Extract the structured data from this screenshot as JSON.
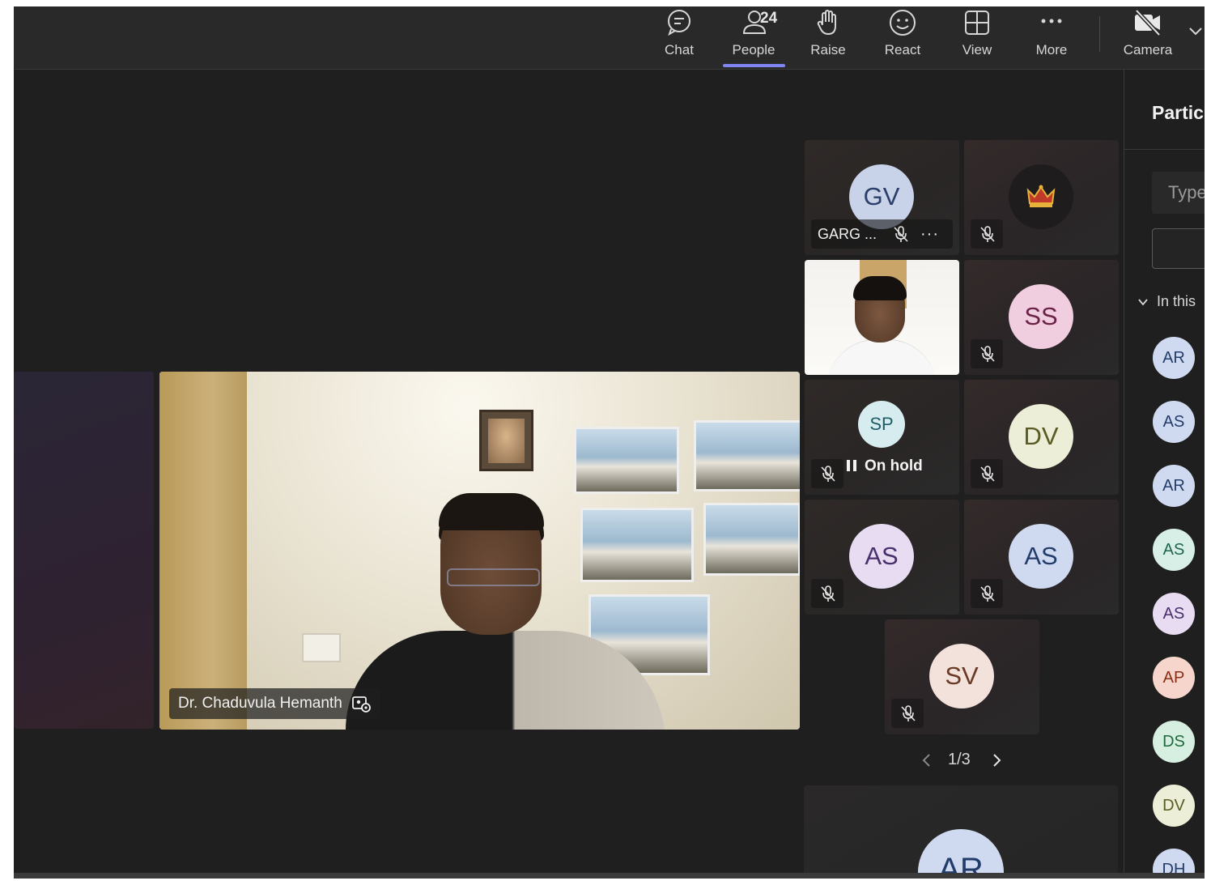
{
  "toolbar": {
    "chat_label": "Chat",
    "people_label": "People",
    "people_count": "24",
    "raise_label": "Raise",
    "react_label": "React",
    "view_label": "View",
    "more_label": "More",
    "camera_label": "Camera",
    "active_tab": "People",
    "accent_color": "#7f85f5"
  },
  "stage": {
    "main_speaker_name": "Dr. Chaduvula Hemanth",
    "tiles": [
      {
        "initials": "GV",
        "name": "GARG ...",
        "avatar_bg": "#c8d2e8",
        "avatar_fg": "#2b3f6b",
        "muted": true
      },
      {
        "initials": "",
        "name": "",
        "icon": "crown-icon",
        "muted": true
      },
      {
        "initials": "",
        "name": "",
        "video": true,
        "muted": false
      },
      {
        "initials": "SS",
        "name": "",
        "avatar_bg": "#f1cde0",
        "avatar_fg": "#6b2248",
        "muted": true
      },
      {
        "initials": "SP",
        "name": "",
        "status": "On hold",
        "avatar_bg": "#d7ecef",
        "avatar_fg": "#1f5d66",
        "muted": true
      },
      {
        "initials": "DV",
        "name": "",
        "avatar_bg": "#eceed7",
        "avatar_fg": "#5a5b24",
        "muted": true
      },
      {
        "initials": "AS",
        "name": "",
        "avatar_bg": "#e7dcf2",
        "avatar_fg": "#4a2f6d",
        "muted": true
      },
      {
        "initials": "AS",
        "name": "",
        "avatar_bg": "#cfdaf0",
        "avatar_fg": "#233d6b",
        "muted": true
      },
      {
        "initials": "SV",
        "name": "",
        "avatar_bg": "#f3e2db",
        "avatar_fg": "#6b3a26",
        "muted": true
      }
    ],
    "pager": "1/3",
    "bottom_tile_initials": "AR"
  },
  "panel": {
    "title": "Partic",
    "search_placeholder": "Type",
    "section_label": "In this",
    "participants": [
      {
        "initials": "AR",
        "bg": "#cfdaf0",
        "fg": "#233d6b"
      },
      {
        "initials": "AS",
        "bg": "#cfdaf0",
        "fg": "#233d6b"
      },
      {
        "initials": "AR",
        "bg": "#cfdaf0",
        "fg": "#233d6b"
      },
      {
        "initials": "AS",
        "bg": "#d7efe6",
        "fg": "#1f6650"
      },
      {
        "initials": "AS",
        "bg": "#e7dcf2",
        "fg": "#4a2f6d"
      },
      {
        "initials": "AP",
        "bg": "#f6d6cc",
        "fg": "#8a2e14"
      },
      {
        "initials": "DS",
        "bg": "#d6efe0",
        "fg": "#1f6a3e"
      },
      {
        "initials": "DV",
        "bg": "#eceed7",
        "fg": "#5a5b24"
      },
      {
        "initials": "DH",
        "bg": "#cfdaf0",
        "fg": "#233d6b"
      }
    ]
  }
}
